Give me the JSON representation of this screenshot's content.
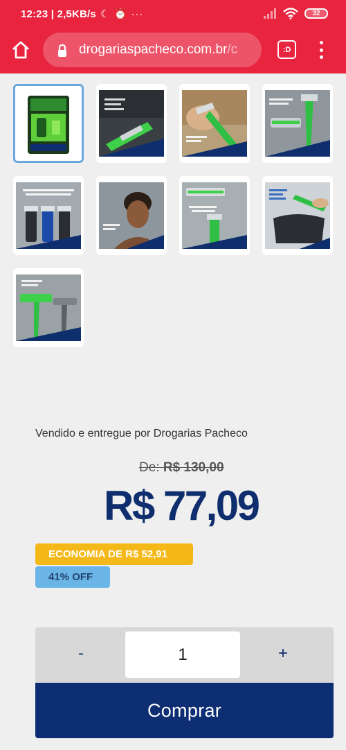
{
  "status_bar": {
    "time_speed": "12:23 | 2,5KB/s",
    "battery": "32",
    "icons": [
      "moon-icon",
      "alarm-icon",
      "more-dots-icon",
      "signal-icon",
      "wifi-icon",
      "battery-icon"
    ]
  },
  "browser": {
    "url_main": "drogariaspacheco.com.br",
    "url_rest": "/c",
    "tabs_label": ":D",
    "accent": "#e8243f"
  },
  "gallery": {
    "thumbnails": [
      {
        "name": "thumbnail-1",
        "selected": true
      },
      {
        "name": "thumbnail-2",
        "selected": false
      },
      {
        "name": "thumbnail-3",
        "selected": false
      },
      {
        "name": "thumbnail-4",
        "selected": false
      },
      {
        "name": "thumbnail-5",
        "selected": false
      },
      {
        "name": "thumbnail-6",
        "selected": false
      },
      {
        "name": "thumbnail-7",
        "selected": false
      },
      {
        "name": "thumbnail-8",
        "selected": false
      },
      {
        "name": "thumbnail-9",
        "selected": false
      }
    ]
  },
  "product": {
    "seller": "Vendido e entregue por Drogarias Pacheco",
    "old_price_label": "De: ",
    "old_price": "R$ 130,00",
    "price": "R$ 77,09",
    "economia": "ECONOMIA DE R$ 52,91",
    "discount": "41% OFF"
  },
  "purchase": {
    "minus_label": "-",
    "quantity": "1",
    "plus_label": "+",
    "buy_label": "Comprar"
  },
  "colors": {
    "brand_blue": "#0d2e73",
    "economia_yellow": "#f4b818",
    "discount_blue": "#6ab4e6",
    "selected_border": "#6aa9dd"
  }
}
